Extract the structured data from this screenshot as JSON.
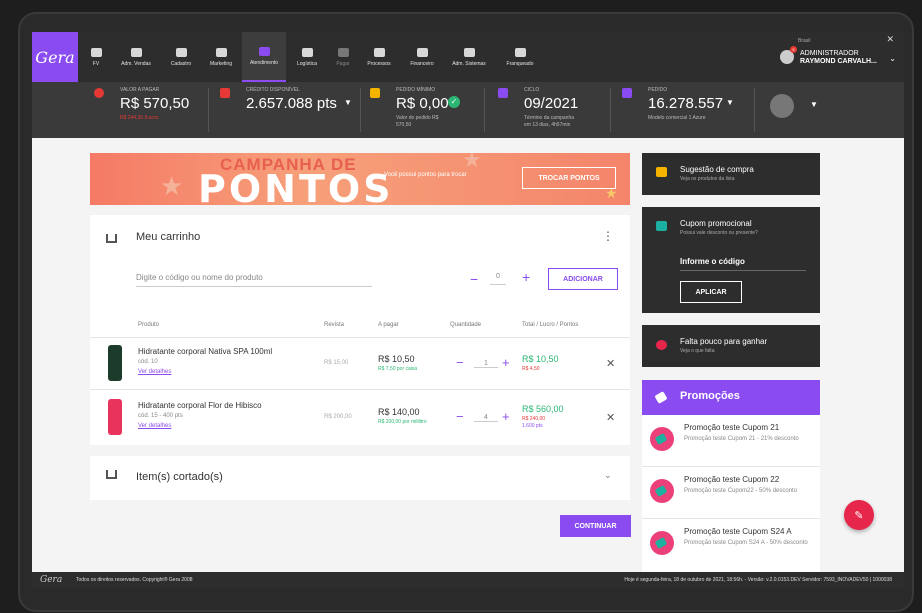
{
  "app": {
    "logo": "Gera"
  },
  "nav": {
    "items": [
      {
        "label": "FV"
      },
      {
        "label": "Adm. Vendas"
      },
      {
        "label": "Cadastro"
      },
      {
        "label": "Marketing"
      },
      {
        "label": "Atendimento"
      },
      {
        "label": "Logística"
      },
      {
        "label": "Pagar"
      },
      {
        "label": "Processos"
      },
      {
        "label": "Financeiro"
      },
      {
        "label": "Adm. Sistemas"
      },
      {
        "label": "Franqueado"
      }
    ],
    "active": "Atendimento"
  },
  "user": {
    "country": "Brasil",
    "notifications": "5",
    "role": "ADMINISTRADOR",
    "name": "RAYMOND CARVALH..."
  },
  "infobar": {
    "valor_label": "VALOR A PAGAR",
    "valor": "R$ 570,50",
    "valor_sub": "R$ 244,30 /Lucro",
    "credito_label": "CRÉDITO DISPONÍVEL",
    "credito": "2.657.088 pts",
    "pedido_min_label": "PEDIDO MÍNIMO",
    "pedido_min": "R$ 0,00",
    "pedido_min_sub1": "Valor do pedido R$",
    "pedido_min_sub2": "570,50",
    "ciclo_label": "CICLO",
    "ciclo": "09/2021",
    "ciclo_sub1": "Término da campanha",
    "ciclo_sub2": "em 13 dias, 4h57min",
    "pedido_label": "PEDIDO",
    "pedido": "16.278.557",
    "pedido_sub": "Modelo comercial 1 Azure"
  },
  "banner": {
    "title1": "CAMPANHA DE",
    "title2": "PONTOS",
    "text": "Você possui pontos para trocar",
    "button": "TROCAR PONTOS"
  },
  "cart": {
    "title": "Meu carrinho",
    "search_placeholder": "Digite o código ou nome do produto",
    "qty_default": "0",
    "add_button": "ADICIONAR",
    "headers": {
      "produto": "Produto",
      "revista": "Revista",
      "apagar": "A pagar",
      "quantidade": "Quantidade",
      "total": "Total / Lucro / Pontos"
    },
    "items": [
      {
        "name": "Hidratante corporal Nativa SPA 100ml",
        "code": "cód. 10",
        "link": "Ver detalhes",
        "revista": "R$ 15,00",
        "price": "R$ 10,50",
        "price_sub": "R$ 7,50 por caixa",
        "qty": "1",
        "total": "R$ 10,50",
        "lucro": "R$ 4,50",
        "pontos": ""
      },
      {
        "name": "Hidratante corporal Flor de Hibisco",
        "code": "cód. 15 - 400 pts",
        "link": "Ver detalhes",
        "revista": "R$ 200,00",
        "price": "R$ 140,00",
        "price_sub": "R$ 200,00 por mililitro",
        "qty": "4",
        "total": "R$ 560,00",
        "lucro": "R$ 240,00",
        "pontos": "1.600 pts"
      }
    ],
    "cut_title": "Item(s) cortado(s)",
    "continue_button": "CONTINUAR"
  },
  "sidebar": {
    "sugestao_title": "Sugestão de compra",
    "sugestao_sub": "Veja os produtos da lista",
    "cupom_title": "Cupom promocional",
    "cupom_sub": "Possui vale desconto ou presente?",
    "cupom_input": "Informe o código",
    "cupom_button": "APLICAR",
    "falta_title": "Falta pouco para ganhar",
    "falta_sub": "Veja o que falta",
    "promos_title": "Promoções",
    "promos": [
      {
        "title": "Promoção teste Cupom 21",
        "desc": "Promoção teste Cupom 21 - 21% desconto"
      },
      {
        "title": "Promoção teste Cupom 22",
        "desc": "Promoção teste Cupom22 - 50% desconto"
      },
      {
        "title": "Promoção teste Cupom S24 A",
        "desc": "Promoção teste Cupom S24 A - 50% desconto"
      }
    ]
  },
  "footer": {
    "logo": "Gera",
    "copyright": "Todos os direitos reservados. Copyright® Gera 2008",
    "version": "Hoje é segunda-feira, 18 de outubro de 2021, 18:56h. - Versão: v.2.0.0153.DEV Servidor: 7593_INOVADEV50 | 1000038"
  },
  "colors": {
    "accent": "#8a4cf0",
    "dark": "#2d2d2d",
    "green": "#2bb673",
    "red": "#e53935",
    "fab": "#e6264a"
  }
}
